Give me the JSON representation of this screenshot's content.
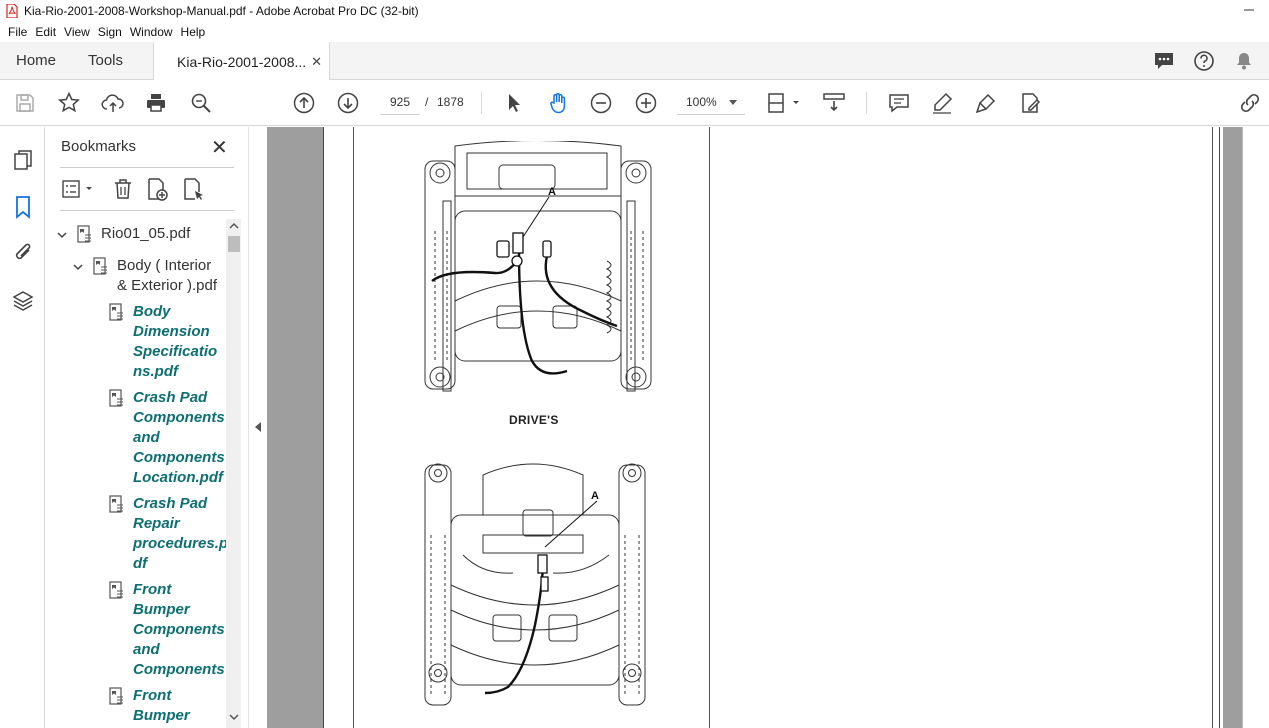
{
  "window": {
    "title": "Kia-Rio-2001-2008-Workshop-Manual.pdf - Adobe Acrobat Pro DC (32-bit)"
  },
  "menu": [
    "File",
    "Edit",
    "View",
    "Sign",
    "Window",
    "Help"
  ],
  "tabs": {
    "home": "Home",
    "tools": "Tools",
    "document": "Kia-Rio-2001-2008..."
  },
  "toolbar": {
    "current_page": "925",
    "page_separator": "/",
    "total_pages": "1878",
    "zoom": "100%"
  },
  "bookmarks": {
    "title": "Bookmarks",
    "items": [
      {
        "label": "Rio01_05.pdf"
      },
      {
        "label": "Body ( Interior",
        "label2": "& Exterior ).pdf"
      },
      {
        "lines": [
          "Body",
          "Dimension",
          "Specificatio",
          "ns.pdf"
        ]
      },
      {
        "lines": [
          "Crash Pad",
          "Components",
          "and",
          "Components",
          "Location.pdf"
        ]
      },
      {
        "lines": [
          "Crash Pad",
          "Repair",
          "procedures.p",
          "df"
        ]
      },
      {
        "lines": [
          "Front",
          "Bumper",
          "Components",
          "and",
          "Components"
        ]
      },
      {
        "lines": [
          "Front",
          "Bumper"
        ]
      }
    ]
  },
  "document": {
    "figure1_label": "A",
    "caption": "DRIVE'S",
    "figure2_label": "A"
  },
  "colors": {
    "bookmark_leaf": "#0e6f72",
    "doc_background": "#9e9e9e",
    "acrobat_red": "#d7261e"
  }
}
